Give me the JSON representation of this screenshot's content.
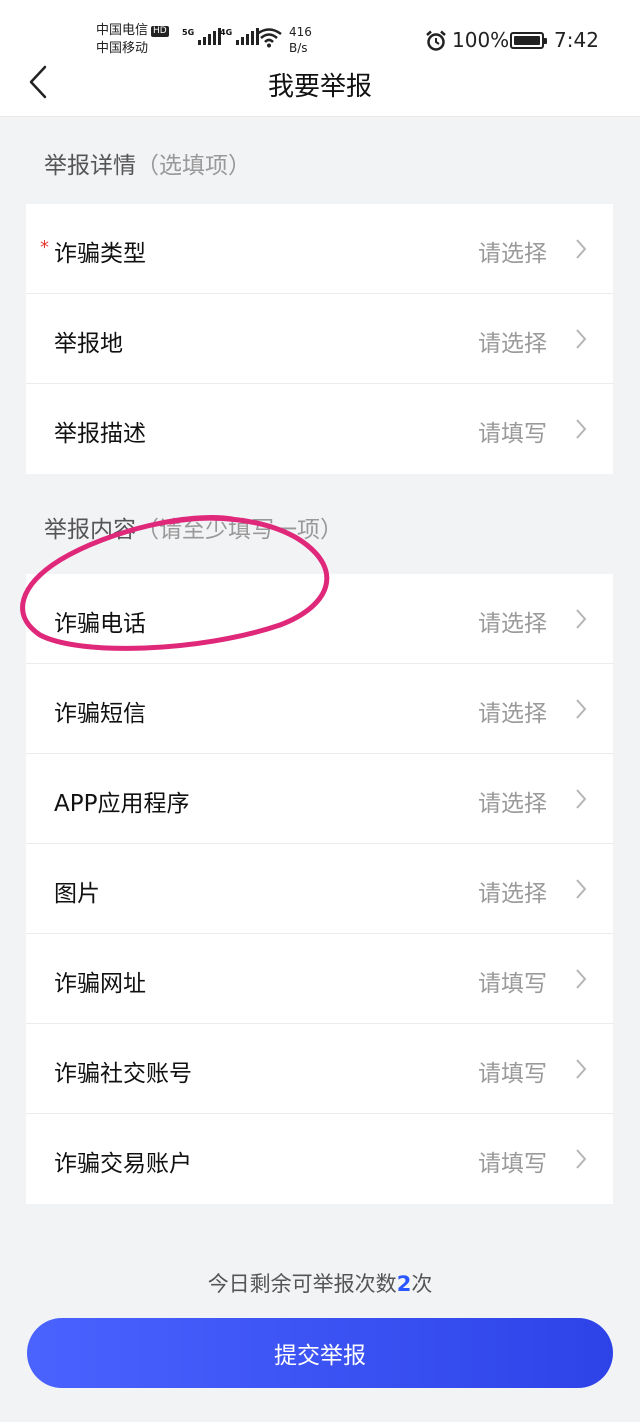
{
  "status_bar": {
    "carrier_1": "中国电信",
    "hd_badge": "HD",
    "carrier_2": "中国移动",
    "network_1": "5G",
    "network_2": "4G",
    "speed_value": "416",
    "speed_unit": "B/s",
    "battery": "100%",
    "time": "7:42"
  },
  "nav": {
    "title": "我要举报"
  },
  "details_section": {
    "title": "举报详情",
    "hint": "（选填项）",
    "rows": [
      {
        "label": "诈骗类型",
        "value": "请选择",
        "required_mark": "*"
      },
      {
        "label": "举报地",
        "value": "请选择"
      },
      {
        "label": "举报描述",
        "value": "请填写"
      }
    ]
  },
  "content_section": {
    "title": "举报内容",
    "hint": "（请至少填写一项）",
    "rows": [
      {
        "label": "诈骗电话",
        "value": "请选择"
      },
      {
        "label": "诈骗短信",
        "value": "请选择"
      },
      {
        "label": "APP应用程序",
        "value": "请选择"
      },
      {
        "label": "图片",
        "value": "请选择"
      },
      {
        "label": "诈骗网址",
        "value": "请填写"
      },
      {
        "label": "诈骗社交账号",
        "value": "请填写"
      },
      {
        "label": "诈骗交易账户",
        "value": "请填写"
      }
    ]
  },
  "footer": {
    "remaining_prefix": "今日剩余可举报次数",
    "remaining_count": "2",
    "remaining_suffix": "次",
    "submit_label": "提交举报"
  },
  "colors": {
    "accent": "#2d43e8",
    "annotation": "#e0287a",
    "required": "#e53935"
  }
}
